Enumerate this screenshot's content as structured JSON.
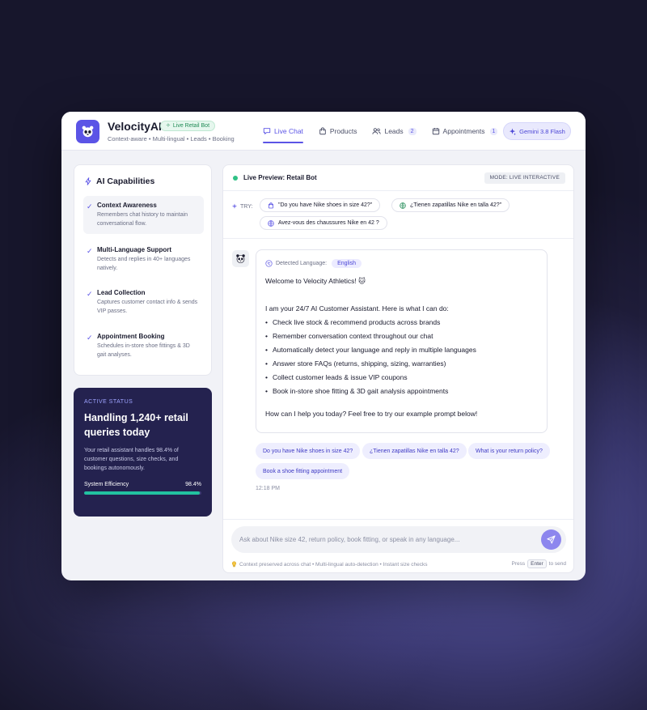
{
  "app": {
    "brand": "VelocityAI",
    "badge": "Live Retail Bot",
    "tagline": "Context-aware • Multi-lingual • Leads • Booking"
  },
  "nav": {
    "live_chat": "Live Chat",
    "products": "Products",
    "leads": "Leads",
    "leads_count": "2",
    "appointments": "Appointments",
    "appointments_count": "1",
    "model": "Gemini 3.8 Flash"
  },
  "sidebar": {
    "title": "AI Capabilities",
    "items": [
      {
        "name": "Context Awareness",
        "desc": "Remembers chat history to maintain conversational flow."
      },
      {
        "name": "Multi-Language Support",
        "desc": "Detects and replies in 40+ languages natively."
      },
      {
        "name": "Lead Collection",
        "desc": "Captures customer contact info & sends VIP passes."
      },
      {
        "name": "Appointment Booking",
        "desc": "Schedules in-store shoe fittings & 3D gait analyses."
      }
    ]
  },
  "status": {
    "label": "ACTIVE STATUS",
    "title": "Handling 1,240+ retail queries today",
    "desc": "Your retail assistant handles 98.4% of customer questions, size checks, and bookings autonomously.",
    "efficiency_label": "System Efficiency",
    "efficiency_value": "98.4%",
    "efficiency_fraction": 0.984
  },
  "chat": {
    "title": "Live Preview: Retail Bot",
    "mode": "MODE: LIVE INTERACTIVE",
    "try_label": "TRY:",
    "try_chips": [
      "\"Do you have Nike shoes in size 42?\"",
      "¿Tienen zapatillas Nike en talla 42?\"",
      "Avez-vous des chaussures Nike en 42 ?"
    ],
    "detected_label": "Detected Language:",
    "detected_value": "English",
    "greeting": "Welcome to Velocity Athletics! 🐱",
    "intro": "I am your 24/7 AI Customer Assistant. Here is what I can do:",
    "bullets": [
      "Check live stock & recommend products across brands",
      "Remember conversation context throughout our chat",
      "Automatically detect your language and reply in multiple languages",
      "Answer store FAQs (returns, shipping, sizing, warranties)",
      "Collect customer leads & issue VIP coupons",
      "Book in-store shoe fitting & 3D gait analysis appointments"
    ],
    "closing": "How can I help you today? Feel free to try our example prompt below!",
    "suggestions": [
      "Do you have Nike shoes in size 42?",
      "¿Tienen zapatillas Nike en talla 42?",
      "What is your return policy?",
      "Book a shoe fitting appointment"
    ],
    "time": "12:18 PM",
    "input_placeholder": "Ask about Nike size 42, return policy, book fitting, or speak in any language...",
    "hint": "Context preserved across chat • Multi-lingual auto-detection • Instant size checks",
    "press_prefix": "Press",
    "press_key": "Enter",
    "press_suffix": "to send"
  },
  "colors": {
    "accent": "#5b54e6",
    "live_green": "#2fc185",
    "status_bg": "#24224f",
    "efficiency_bar": "#22c2a0"
  }
}
